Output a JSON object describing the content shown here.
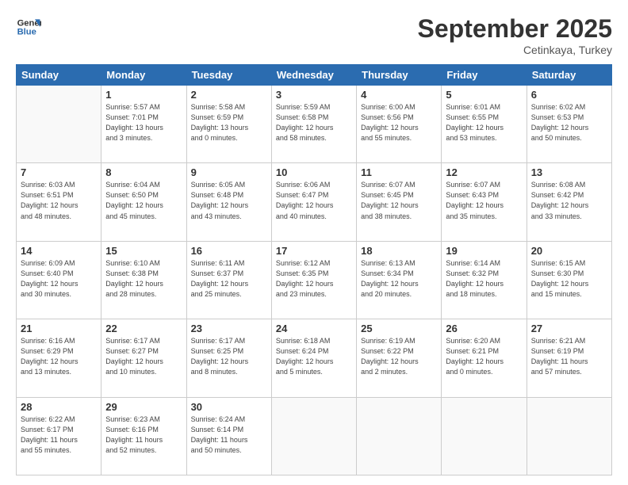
{
  "logo": {
    "line1": "General",
    "line2": "Blue"
  },
  "title": "September 2025",
  "subtitle": "Cetinkaya, Turkey",
  "days_of_week": [
    "Sunday",
    "Monday",
    "Tuesday",
    "Wednesday",
    "Thursday",
    "Friday",
    "Saturday"
  ],
  "weeks": [
    [
      {
        "day": "",
        "info": ""
      },
      {
        "day": "1",
        "info": "Sunrise: 5:57 AM\nSunset: 7:01 PM\nDaylight: 13 hours\nand 3 minutes."
      },
      {
        "day": "2",
        "info": "Sunrise: 5:58 AM\nSunset: 6:59 PM\nDaylight: 13 hours\nand 0 minutes."
      },
      {
        "day": "3",
        "info": "Sunrise: 5:59 AM\nSunset: 6:58 PM\nDaylight: 12 hours\nand 58 minutes."
      },
      {
        "day": "4",
        "info": "Sunrise: 6:00 AM\nSunset: 6:56 PM\nDaylight: 12 hours\nand 55 minutes."
      },
      {
        "day": "5",
        "info": "Sunrise: 6:01 AM\nSunset: 6:55 PM\nDaylight: 12 hours\nand 53 minutes."
      },
      {
        "day": "6",
        "info": "Sunrise: 6:02 AM\nSunset: 6:53 PM\nDaylight: 12 hours\nand 50 minutes."
      }
    ],
    [
      {
        "day": "7",
        "info": "Sunrise: 6:03 AM\nSunset: 6:51 PM\nDaylight: 12 hours\nand 48 minutes."
      },
      {
        "day": "8",
        "info": "Sunrise: 6:04 AM\nSunset: 6:50 PM\nDaylight: 12 hours\nand 45 minutes."
      },
      {
        "day": "9",
        "info": "Sunrise: 6:05 AM\nSunset: 6:48 PM\nDaylight: 12 hours\nand 43 minutes."
      },
      {
        "day": "10",
        "info": "Sunrise: 6:06 AM\nSunset: 6:47 PM\nDaylight: 12 hours\nand 40 minutes."
      },
      {
        "day": "11",
        "info": "Sunrise: 6:07 AM\nSunset: 6:45 PM\nDaylight: 12 hours\nand 38 minutes."
      },
      {
        "day": "12",
        "info": "Sunrise: 6:07 AM\nSunset: 6:43 PM\nDaylight: 12 hours\nand 35 minutes."
      },
      {
        "day": "13",
        "info": "Sunrise: 6:08 AM\nSunset: 6:42 PM\nDaylight: 12 hours\nand 33 minutes."
      }
    ],
    [
      {
        "day": "14",
        "info": "Sunrise: 6:09 AM\nSunset: 6:40 PM\nDaylight: 12 hours\nand 30 minutes."
      },
      {
        "day": "15",
        "info": "Sunrise: 6:10 AM\nSunset: 6:38 PM\nDaylight: 12 hours\nand 28 minutes."
      },
      {
        "day": "16",
        "info": "Sunrise: 6:11 AM\nSunset: 6:37 PM\nDaylight: 12 hours\nand 25 minutes."
      },
      {
        "day": "17",
        "info": "Sunrise: 6:12 AM\nSunset: 6:35 PM\nDaylight: 12 hours\nand 23 minutes."
      },
      {
        "day": "18",
        "info": "Sunrise: 6:13 AM\nSunset: 6:34 PM\nDaylight: 12 hours\nand 20 minutes."
      },
      {
        "day": "19",
        "info": "Sunrise: 6:14 AM\nSunset: 6:32 PM\nDaylight: 12 hours\nand 18 minutes."
      },
      {
        "day": "20",
        "info": "Sunrise: 6:15 AM\nSunset: 6:30 PM\nDaylight: 12 hours\nand 15 minutes."
      }
    ],
    [
      {
        "day": "21",
        "info": "Sunrise: 6:16 AM\nSunset: 6:29 PM\nDaylight: 12 hours\nand 13 minutes."
      },
      {
        "day": "22",
        "info": "Sunrise: 6:17 AM\nSunset: 6:27 PM\nDaylight: 12 hours\nand 10 minutes."
      },
      {
        "day": "23",
        "info": "Sunrise: 6:17 AM\nSunset: 6:25 PM\nDaylight: 12 hours\nand 8 minutes."
      },
      {
        "day": "24",
        "info": "Sunrise: 6:18 AM\nSunset: 6:24 PM\nDaylight: 12 hours\nand 5 minutes."
      },
      {
        "day": "25",
        "info": "Sunrise: 6:19 AM\nSunset: 6:22 PM\nDaylight: 12 hours\nand 2 minutes."
      },
      {
        "day": "26",
        "info": "Sunrise: 6:20 AM\nSunset: 6:21 PM\nDaylight: 12 hours\nand 0 minutes."
      },
      {
        "day": "27",
        "info": "Sunrise: 6:21 AM\nSunset: 6:19 PM\nDaylight: 11 hours\nand 57 minutes."
      }
    ],
    [
      {
        "day": "28",
        "info": "Sunrise: 6:22 AM\nSunset: 6:17 PM\nDaylight: 11 hours\nand 55 minutes."
      },
      {
        "day": "29",
        "info": "Sunrise: 6:23 AM\nSunset: 6:16 PM\nDaylight: 11 hours\nand 52 minutes."
      },
      {
        "day": "30",
        "info": "Sunrise: 6:24 AM\nSunset: 6:14 PM\nDaylight: 11 hours\nand 50 minutes."
      },
      {
        "day": "",
        "info": ""
      },
      {
        "day": "",
        "info": ""
      },
      {
        "day": "",
        "info": ""
      },
      {
        "day": "",
        "info": ""
      }
    ]
  ]
}
